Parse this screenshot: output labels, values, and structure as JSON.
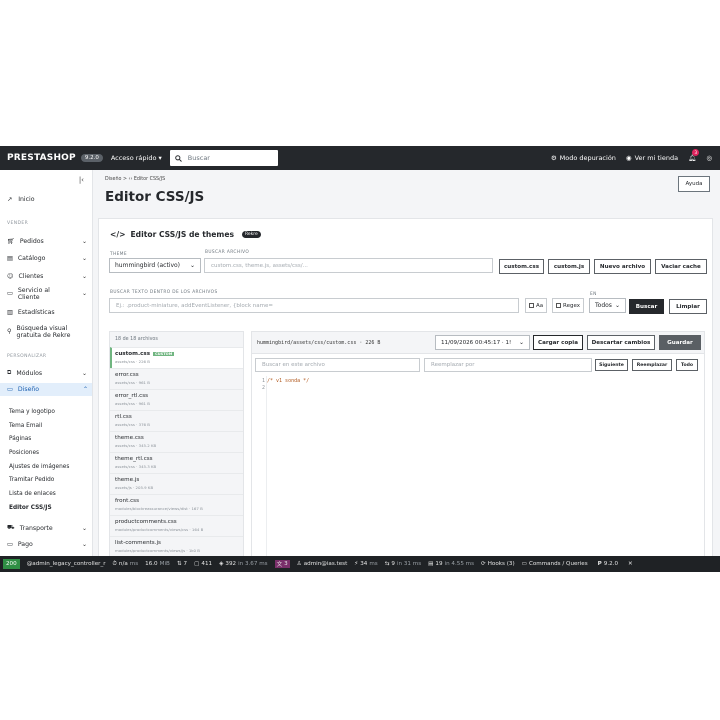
{
  "topbar": {
    "logo": "PRESTASHOP",
    "version": "9.2.0",
    "quick_access": "Acceso rápido",
    "search_placeholder": "Buscar",
    "debug_mode": "Modo depuración",
    "view_store": "Ver mi tienda",
    "notification_count": "3"
  },
  "sidebar": {
    "home": "Inicio",
    "section_sell": "VENDER",
    "items": [
      {
        "label": "Pedidos"
      },
      {
        "label": "Catálogo"
      },
      {
        "label": "Clientes"
      },
      {
        "label": "Servicio al Cliente"
      },
      {
        "label": "Estadísticas"
      },
      {
        "label": "Búsqueda visual gratuita de Rekre"
      }
    ],
    "section_customize": "PERSONALIZAR",
    "modules": "Módulos",
    "design": "Diseño",
    "design_sub": [
      "Tema y logotipo",
      "Tema Email",
      "Páginas",
      "Posiciones",
      "Ajustes de imágenes",
      "Tramitar Pedido",
      "Lista de enlaces",
      "Editor CSS/JS"
    ],
    "transport": "Transporte",
    "payment": "Pago"
  },
  "header": {
    "breadcrumb": "Diseño  >  ‹› Editor CSS/JS",
    "title": "Editor CSS/JS",
    "help": "Ayuda"
  },
  "card": {
    "title": "Editor CSS/JS de themes",
    "badge": "Rekre",
    "theme_label": "THEME",
    "theme_value": "hummingbird (activo)",
    "search_file_label": "BUSCAR ARCHIVO",
    "search_file_placeholder": "custom.css, theme.js, assets/css/...",
    "btn_custom_css": "custom.css",
    "btn_custom_js": "custom.js",
    "btn_new_file": "Nuevo archivo",
    "btn_clear_cache": "Vaciar cache",
    "search_text_label": "BUSCAR TEXTO DENTRO DE LOS ARCHIVOS",
    "search_text_placeholder": "Ej.: .product-miniature, addEventListener, {block name=",
    "aa": "Aa",
    "regex": "Regex",
    "in_label": "EN",
    "in_value": "Todos",
    "btn_search": "Buscar",
    "btn_clean": "Limpiar"
  },
  "files": {
    "count": "18 de 18 archivos",
    "custom_badge": "CUSTOM",
    "items": [
      {
        "name": "custom.css",
        "path": "assets/css · 226 B"
      },
      {
        "name": "error.css",
        "path": "assets/css · 961 B"
      },
      {
        "name": "error_rtl.css",
        "path": "assets/css · 961 B"
      },
      {
        "name": "rtl.css",
        "path": "assets/css · 376 B"
      },
      {
        "name": "theme.css",
        "path": "assets/css · 345.2 KB"
      },
      {
        "name": "theme_rtl.css",
        "path": "assets/css · 345.3 KB"
      },
      {
        "name": "theme.js",
        "path": "assets/js · 205.9 KB"
      },
      {
        "name": "front.css",
        "path": "modules/blockreassurance/views/dist · 167 B"
      },
      {
        "name": "productcomments.css",
        "path": "modules/productcomments/views/css · 164 B"
      },
      {
        "name": "list-comments.js",
        "path": "modules/productcomments/views/js · 1k0 B"
      }
    ]
  },
  "editor": {
    "path": "hummingbird/assets/css/custom.css · 226 B",
    "backup_value": "11/09/2026 00:45:17 · 1!",
    "btn_load_copy": "Cargar copia",
    "btn_discard": "Descartar cambios",
    "btn_save": "Guardar",
    "search_placeholder": "Buscar en este archivo",
    "replace_placeholder": "Reemplazar por",
    "btn_next": "Siguiente",
    "btn_replace": "Reemplazar",
    "btn_all": "Todo",
    "line_numbers": [
      "1",
      "2"
    ],
    "code_lines": [
      "/* v1 sonda */",
      ""
    ]
  },
  "footer": {
    "status": "200",
    "route": "@admin_legacy_controller_r",
    "time": "n/a",
    "time_unit": "ms",
    "memory": "16.0",
    "memory_unit": "MiB",
    "forms": "7",
    "twig": "411",
    "cache": "392",
    "cache_time": "in 3.67 ms",
    "translations": "3",
    "user": "admin@ias.test",
    "events": "34",
    "events_unit": "ms",
    "requests": "9",
    "requests_time": "in 31 ms",
    "db": "19",
    "db_time": "in 4.55 ms",
    "hooks": "Hooks (3)",
    "commands": "Commands / Queries",
    "ps_version": "9.2.0"
  }
}
